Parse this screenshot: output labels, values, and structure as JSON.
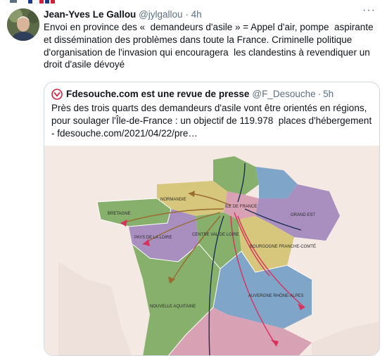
{
  "tweet": {
    "author_name": "Jean-Yves Le Gallou",
    "author_handle": "@jylgallou",
    "separator": "·",
    "time": "4h",
    "more_label": "···",
    "text": "Envoi en province des «  demandeurs d'asile » = Appel d'air, pompe  aspirante et dissémination des problèmes dans toute la France. Criminelle politique d'organisation de l'invasion qui encouragera  les clandestins à revendiquer un droit d'asile dévoyé"
  },
  "quote": {
    "author_name": "Fdesouche.com est une revue de presse",
    "author_handle": "@F_Desouche",
    "separator": "·",
    "time": "5h",
    "text": "Près des trois quarts des demandeurs d'asile vont être orientés en régions, pour soulager l'Île-de-France : un objectif de 119.978  places d'hébergement - fdesouche.com/2021/04/22/pre…",
    "map_labels": {
      "normandie": "NORMANDIE",
      "bretagne": "BRETAGNE",
      "pays_de_la_loire": "PAYS DE LA LOIRE",
      "centre_val_de_loire": "CENTRE VAL DE LOIRE",
      "ile_de_france": "ILE DE FRANCE",
      "grand_est": "GRAND EST",
      "bourgogne": "BOURGOGNE FRANCHE-COMTÉ",
      "nouvelle_aquitaine": "NOUVELLE AQUITAINE",
      "auvergne": "AUVERGNE RHÔNE-ALPES"
    }
  },
  "colors": {
    "map_background": "#f5e9e4",
    "arrow_red": "#d9305d",
    "arrow_brown": "#9a6a2f",
    "arrow_navy": "#1f2e55",
    "region_green": "#86b06b",
    "region_purple": "#a88fbf",
    "region_blue": "#7fa6c9",
    "region_yellow": "#d7c77c",
    "region_pink": "#d9a1b4"
  }
}
